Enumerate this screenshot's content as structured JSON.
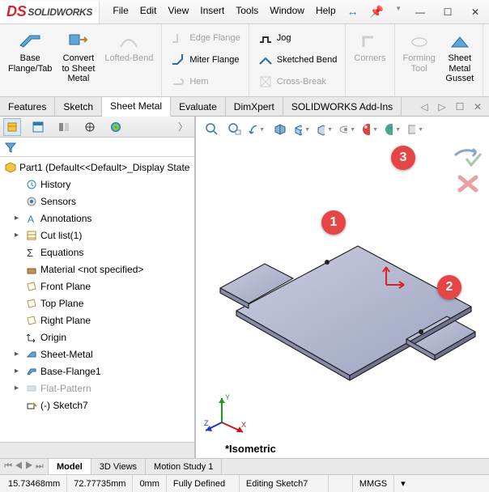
{
  "app": {
    "name": "SOLIDWORKS"
  },
  "menu": [
    "File",
    "Edit",
    "View",
    "Insert",
    "Tools",
    "Window",
    "Help"
  ],
  "ribbon": {
    "base_flange": "Base\nFlange/Tab",
    "convert": "Convert\nto Sheet\nMetal",
    "lofted": "Lofted-Bend",
    "edge_flange": "Edge Flange",
    "miter_flange": "Miter Flange",
    "hem": "Hem",
    "jog": "Jog",
    "sketched_bend": "Sketched Bend",
    "cross_break": "Cross-Break",
    "corners": "Corners",
    "forming_tool": "Forming\nTool",
    "gusset": "Sheet\nMetal\nGusset"
  },
  "cm_tabs": [
    "Features",
    "Sketch",
    "Sheet Metal",
    "Evaluate",
    "DimXpert",
    "SOLIDWORKS Add-Ins"
  ],
  "cm_active": "Sheet Metal",
  "tree": {
    "root": "Part1  (Default<<Default>_Display State",
    "items": [
      {
        "label": "History",
        "icon": "history"
      },
      {
        "label": "Sensors",
        "icon": "sensors"
      },
      {
        "label": "Annotations",
        "icon": "annotations",
        "expandable": true
      },
      {
        "label": "Cut list(1)",
        "icon": "cutlist",
        "expandable": true
      },
      {
        "label": "Equations",
        "icon": "equations"
      },
      {
        "label": "Material <not specified>",
        "icon": "material"
      },
      {
        "label": "Front Plane",
        "icon": "plane"
      },
      {
        "label": "Top Plane",
        "icon": "plane"
      },
      {
        "label": "Right Plane",
        "icon": "plane"
      },
      {
        "label": "Origin",
        "icon": "origin"
      },
      {
        "label": "Sheet-Metal",
        "icon": "sheetmetal",
        "expandable": true
      },
      {
        "label": "Base-Flange1",
        "icon": "baseflange",
        "expandable": true
      },
      {
        "label": "Flat-Pattern",
        "icon": "flatpattern",
        "expandable": true,
        "suppressed": true
      },
      {
        "label": "(-) Sketch7",
        "icon": "sketch"
      }
    ]
  },
  "viewport": {
    "label": "*Isometric",
    "callouts": [
      "1",
      "2",
      "3"
    ]
  },
  "bottom_tabs": [
    "Model",
    "3D Views",
    "Motion Study 1"
  ],
  "status": {
    "coord_x": "15.73468mm",
    "coord_y": "72.77735mm",
    "coord_z": "0mm",
    "state": "Fully Defined",
    "editing": "Editing Sketch7",
    "units": "MMGS"
  }
}
